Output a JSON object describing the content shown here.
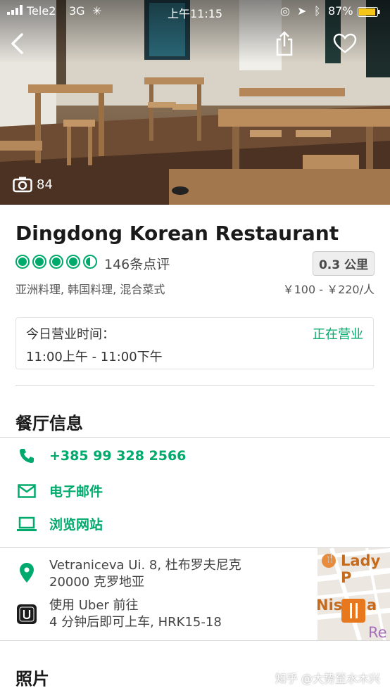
{
  "status_bar": {
    "carrier": "Tele2",
    "network": "3G",
    "time": "上午11:15",
    "battery": "87%"
  },
  "hero": {
    "photo_count": "84"
  },
  "restaurant": {
    "name": "Dingdong Korean Restaurant",
    "rating_value": 4.5,
    "reviews": "146条点评",
    "distance": "0.3 公里",
    "cuisine": "亚洲料理, 韩国料理, 混合菜式",
    "price": "￥100 - ￥220/人"
  },
  "hours": {
    "label": "今日营业时间：",
    "status": "正在营业",
    "time": "11:00上午 - 11:00下午"
  },
  "info": {
    "title": "餐厅信息",
    "phone": "+385 99 328 2566",
    "email": "电子邮件",
    "website": "浏览网站"
  },
  "location": {
    "address_line1": "Vetraniceva Ui. 8, 杜布罗夫尼克",
    "address_line2": "20000 克罗地亚",
    "uber_line1": "使用 Uber 前往",
    "uber_line2": "4 分钟后即可上车, HRK15-18",
    "map_label_1": "Lady P",
    "map_label_2": "Nis",
    "map_label_3": "a",
    "map_label_4": "Re"
  },
  "photos": {
    "title": "照片"
  },
  "watermark": "知乎 @大势至水木兴",
  "colors": {
    "accent": "#00aa6c"
  }
}
